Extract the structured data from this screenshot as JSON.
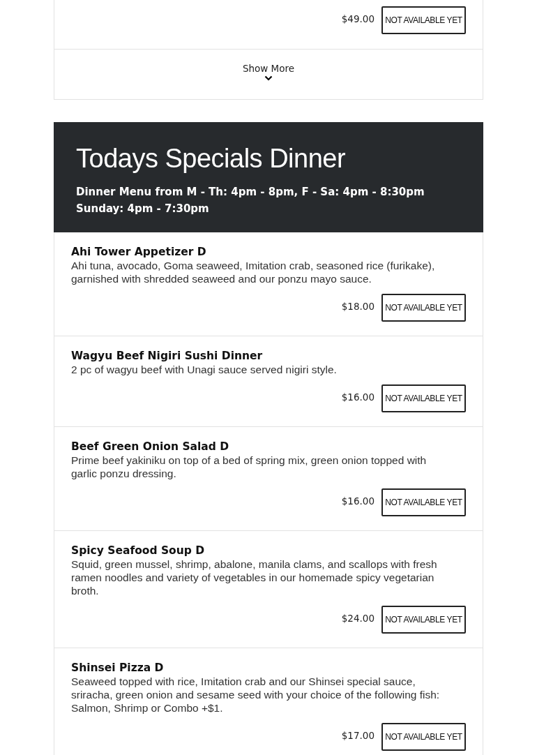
{
  "previous_item": {
    "price": "$49.00",
    "button": "NOT AVAILABLE YET"
  },
  "show_more": {
    "label": "Show More"
  },
  "section": {
    "title": "Todays Specials Dinner",
    "subtitle": "Dinner Menu from M - Th: 4pm - 8pm, F - Sa: 4pm - 8:30pm Sunday: 4pm - 7:30pm"
  },
  "items": [
    {
      "name": "Ahi Tower Appetizer D",
      "description": "Ahi tuna, avocado, Goma seaweed, Imitation crab, seasoned rice (furikake), garnished with shredded seaweed and our ponzu mayo sauce.",
      "price": "$18.00",
      "button": "NOT AVAILABLE YET"
    },
    {
      "name": "Wagyu Beef Nigiri Sushi Dinner",
      "description": "2 pc of wagyu beef with Unagi sauce served nigiri style.",
      "price": "$16.00",
      "button": "NOT AVAILABLE YET"
    },
    {
      "name": "Beef Green Onion Salad D",
      "description": "Prime beef yakiniku on top of a bed of spring mix, green onion topped with garlic ponzu dressing.",
      "price": "$16.00",
      "button": "NOT AVAILABLE YET"
    },
    {
      "name": "Spicy Seafood Soup D",
      "description": "Squid, green mussel, shrimp, abalone, manila clams, and scallops with fresh ramen noodles and variety of vegetables in our homemade spicy vegetarian broth.",
      "price": "$24.00",
      "button": "NOT AVAILABLE YET"
    },
    {
      "name": "Shinsei Pizza D",
      "description": "Seaweed topped with rice, Imitation crab and our Shinsei special sauce, sriracha, green onion and sesame seed with your choice of the following fish: Salmon, Shrimp or Combo +$1.",
      "price": "$17.00",
      "button": "NOT AVAILABLE YET"
    }
  ]
}
